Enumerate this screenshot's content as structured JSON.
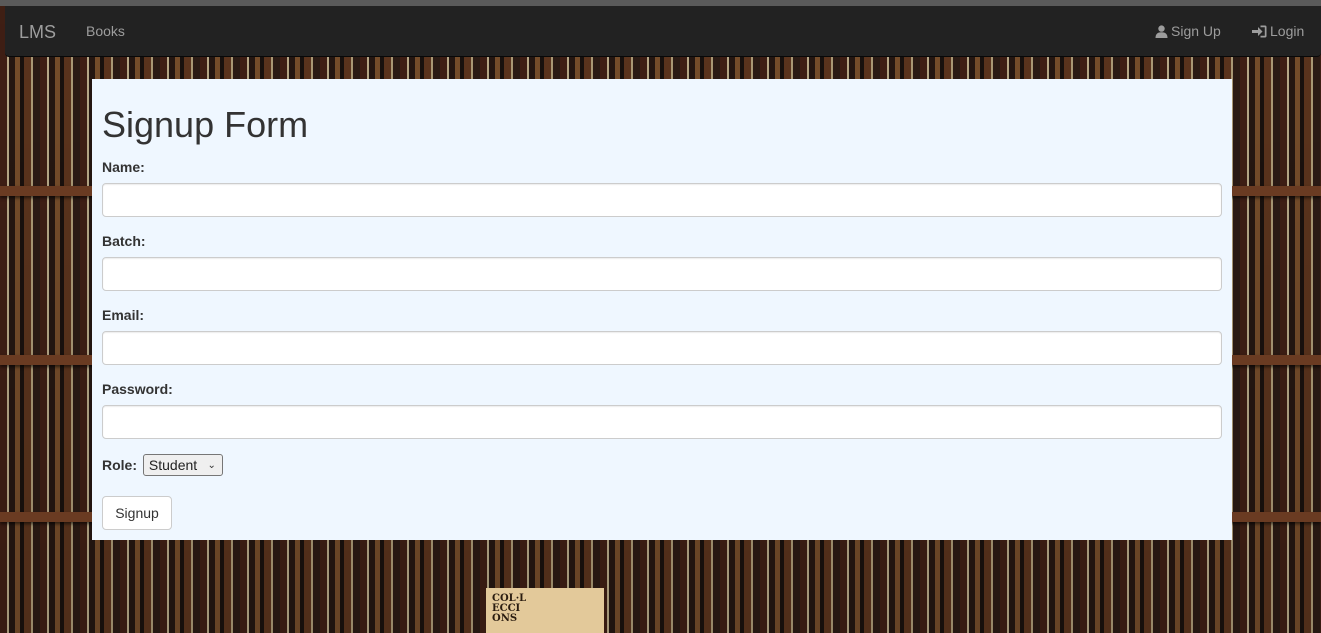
{
  "navbar": {
    "brand": "LMS",
    "links": [
      {
        "label": "Books"
      }
    ],
    "right": [
      {
        "label": "Sign Up",
        "icon": "user-icon"
      },
      {
        "label": "Login",
        "icon": "log-in-icon"
      }
    ]
  },
  "background": {
    "book_card_lines": [
      "COL·L",
      "ECCI",
      "ONS"
    ]
  },
  "form": {
    "title": "Signup Form",
    "fields": [
      {
        "label": "Name:",
        "value": "",
        "placeholder": ""
      },
      {
        "label": "Batch:",
        "value": "",
        "placeholder": ""
      },
      {
        "label": "Email:",
        "value": "",
        "placeholder": ""
      },
      {
        "label": "Password:",
        "value": "",
        "placeholder": ""
      }
    ],
    "role": {
      "label": "Role:",
      "selected": "Student"
    },
    "submit_label": "Signup"
  },
  "colors": {
    "navbar_bg": "#222222",
    "nav_text": "#9d9d9d",
    "panel_bg": "#eff7ff"
  }
}
